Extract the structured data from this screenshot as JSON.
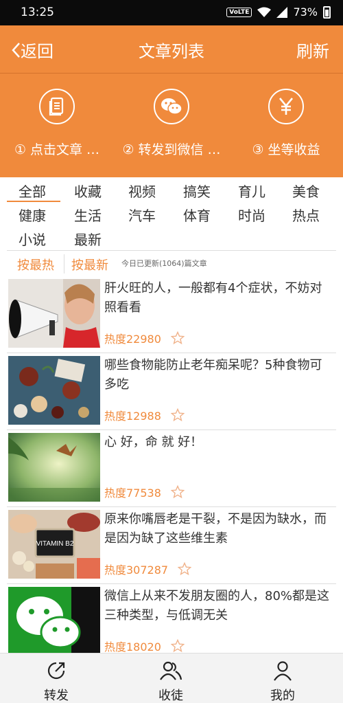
{
  "status": {
    "time": "13:25",
    "volte": "VoLTE",
    "battery": "73%"
  },
  "nav": {
    "back": "返回",
    "title": "文章列表",
    "refresh": "刷新"
  },
  "steps": [
    {
      "label": "① 点击文章 …",
      "icon": "document-icon"
    },
    {
      "label": "② 转发到微信 …",
      "icon": "wechat-icon"
    },
    {
      "label": "③ 坐等收益",
      "icon": "yen-icon"
    }
  ],
  "categories": [
    "全部",
    "收藏",
    "视频",
    "搞笑",
    "育儿",
    "美食",
    "健康",
    "生活",
    "汽车",
    "体育",
    "时尚",
    "热点",
    "小说",
    "最新"
  ],
  "active_category": "全部",
  "sort": {
    "hot": "按最热",
    "new": "按最新",
    "note": "今日已更新(1064)篇文章"
  },
  "articles": [
    {
      "title": "肝火旺的人，一般都有4个症状，不妨对照看看",
      "heat": "热度22980"
    },
    {
      "title": "哪些食物能防止老年痴呆呢？5种食物可多吃",
      "heat": "热度12988"
    },
    {
      "title": "心 好，命 就 好！",
      "heat": "热度77538"
    },
    {
      "title": "原来你嘴唇老是干裂，不是因为缺水，而是因为缺了这些维生素",
      "heat": "热度307287",
      "thumb_text": "VITAMIN B2"
    },
    {
      "title": "微信上从来不发朋友圈的人，80%都是这三种类型，与低调无关",
      "heat": "热度18020"
    }
  ],
  "tabs": [
    {
      "label": "转发",
      "icon": "share-icon"
    },
    {
      "label": "收徒",
      "icon": "users-icon"
    },
    {
      "label": "我的",
      "icon": "user-icon"
    }
  ],
  "colors": {
    "accent": "#f08a3c",
    "statusbar": "#0b0b0b"
  }
}
